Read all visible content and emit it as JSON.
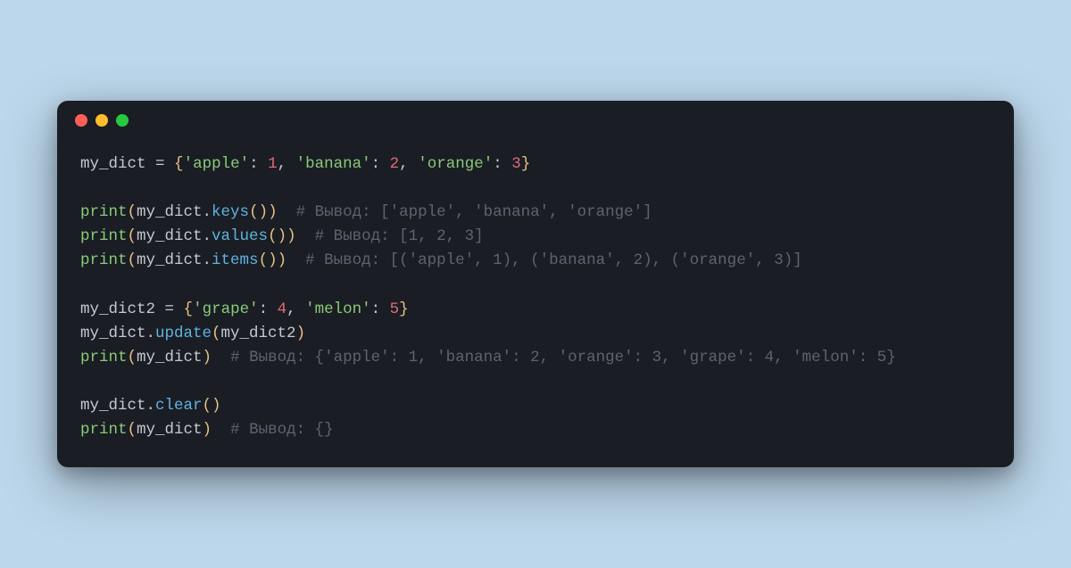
{
  "colors": {
    "background": "#bcd7eb",
    "window_bg": "#1a1d24",
    "dot_red": "#ff5f56",
    "dot_yellow": "#ffbd2e",
    "dot_green": "#27c93f",
    "text_default": "#c6c8d1",
    "text_string": "#89ca78",
    "text_number": "#e06c75",
    "text_func": "#5fb3e0",
    "text_brace": "#e7c184",
    "text_comment": "#5c6370"
  },
  "code": {
    "lines": [
      [
        {
          "t": "my_dict ",
          "c": "ident"
        },
        {
          "t": "=",
          "c": "punct"
        },
        {
          "t": " ",
          "c": "punct"
        },
        {
          "t": "{",
          "c": "brace"
        },
        {
          "t": "'apple'",
          "c": "string"
        },
        {
          "t": ": ",
          "c": "punct"
        },
        {
          "t": "1",
          "c": "number"
        },
        {
          "t": ", ",
          "c": "punct"
        },
        {
          "t": "'banana'",
          "c": "string"
        },
        {
          "t": ": ",
          "c": "punct"
        },
        {
          "t": "2",
          "c": "number"
        },
        {
          "t": ", ",
          "c": "punct"
        },
        {
          "t": "'orange'",
          "c": "string"
        },
        {
          "t": ": ",
          "c": "punct"
        },
        {
          "t": "3",
          "c": "number"
        },
        {
          "t": "}",
          "c": "brace"
        }
      ],
      [],
      [
        {
          "t": "print",
          "c": "builtin"
        },
        {
          "t": "(",
          "c": "brace"
        },
        {
          "t": "my_dict.",
          "c": "ident"
        },
        {
          "t": "keys",
          "c": "method"
        },
        {
          "t": "()",
          "c": "brace"
        },
        {
          "t": ")",
          "c": "brace"
        },
        {
          "t": "  ",
          "c": "punct"
        },
        {
          "t": "# Вывод: ['apple', 'banana', 'orange']",
          "c": "comment"
        }
      ],
      [
        {
          "t": "print",
          "c": "builtin"
        },
        {
          "t": "(",
          "c": "brace"
        },
        {
          "t": "my_dict.",
          "c": "ident"
        },
        {
          "t": "values",
          "c": "method"
        },
        {
          "t": "()",
          "c": "brace"
        },
        {
          "t": ")",
          "c": "brace"
        },
        {
          "t": "  ",
          "c": "punct"
        },
        {
          "t": "# Вывод: [1, 2, 3]",
          "c": "comment"
        }
      ],
      [
        {
          "t": "print",
          "c": "builtin"
        },
        {
          "t": "(",
          "c": "brace"
        },
        {
          "t": "my_dict.",
          "c": "ident"
        },
        {
          "t": "items",
          "c": "method"
        },
        {
          "t": "()",
          "c": "brace"
        },
        {
          "t": ")",
          "c": "brace"
        },
        {
          "t": "  ",
          "c": "punct"
        },
        {
          "t": "# Вывод: [('apple', 1), ('banana', 2), ('orange', 3)]",
          "c": "comment"
        }
      ],
      [],
      [
        {
          "t": "my_dict2 ",
          "c": "ident"
        },
        {
          "t": "=",
          "c": "punct"
        },
        {
          "t": " ",
          "c": "punct"
        },
        {
          "t": "{",
          "c": "brace"
        },
        {
          "t": "'grape'",
          "c": "string"
        },
        {
          "t": ": ",
          "c": "punct"
        },
        {
          "t": "4",
          "c": "number"
        },
        {
          "t": ", ",
          "c": "punct"
        },
        {
          "t": "'melon'",
          "c": "string"
        },
        {
          "t": ": ",
          "c": "punct"
        },
        {
          "t": "5",
          "c": "number"
        },
        {
          "t": "}",
          "c": "brace"
        }
      ],
      [
        {
          "t": "my_dict.",
          "c": "ident"
        },
        {
          "t": "update",
          "c": "method"
        },
        {
          "t": "(",
          "c": "brace"
        },
        {
          "t": "my_dict2",
          "c": "ident"
        },
        {
          "t": ")",
          "c": "brace"
        }
      ],
      [
        {
          "t": "print",
          "c": "builtin"
        },
        {
          "t": "(",
          "c": "brace"
        },
        {
          "t": "my_dict",
          "c": "ident"
        },
        {
          "t": ")",
          "c": "brace"
        },
        {
          "t": "  ",
          "c": "punct"
        },
        {
          "t": "# Вывод: {'apple': 1, 'banana': 2, 'orange': 3, 'grape': 4, 'melon': 5}",
          "c": "comment"
        }
      ],
      [],
      [
        {
          "t": "my_dict.",
          "c": "ident"
        },
        {
          "t": "clear",
          "c": "method"
        },
        {
          "t": "()",
          "c": "brace"
        }
      ],
      [
        {
          "t": "print",
          "c": "builtin"
        },
        {
          "t": "(",
          "c": "brace"
        },
        {
          "t": "my_dict",
          "c": "ident"
        },
        {
          "t": ")",
          "c": "brace"
        },
        {
          "t": "  ",
          "c": "punct"
        },
        {
          "t": "# Вывод: {}",
          "c": "comment"
        }
      ]
    ]
  }
}
